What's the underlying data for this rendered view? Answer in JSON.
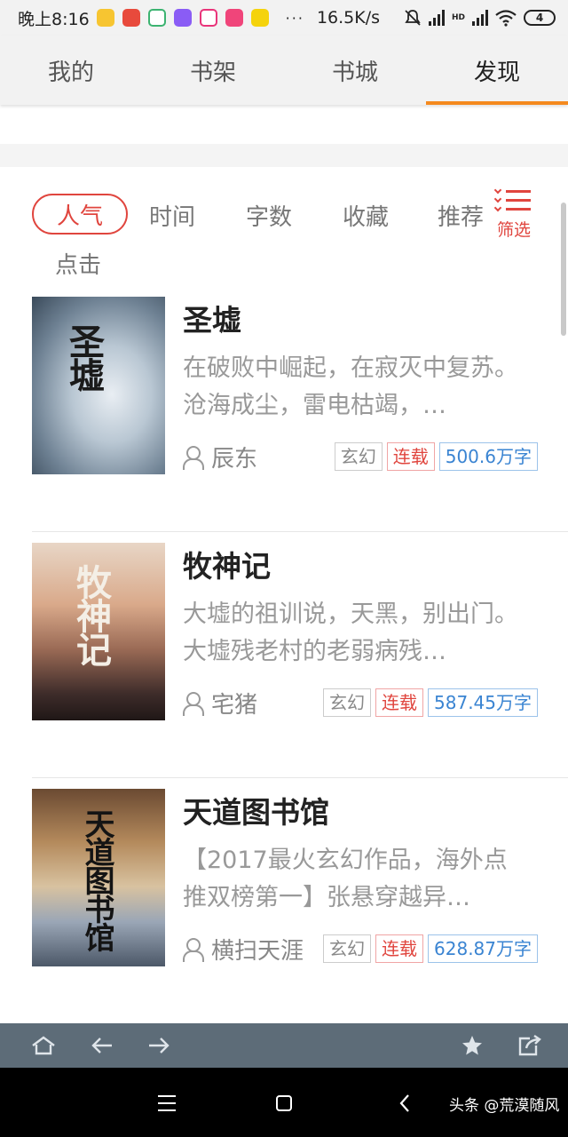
{
  "status_bar": {
    "time": "晚上8:16",
    "dots": "···",
    "speed": "16.5K/s",
    "network": "HD",
    "battery": "4"
  },
  "tabs": [
    {
      "label": "我的",
      "active": false
    },
    {
      "label": "书架",
      "active": false
    },
    {
      "label": "书城",
      "active": false
    },
    {
      "label": "发现",
      "active": true
    }
  ],
  "sort": {
    "options": [
      "人气",
      "时间",
      "字数",
      "收藏",
      "推荐",
      "点击"
    ],
    "active": "人气",
    "filter_label": "筛选"
  },
  "books": [
    {
      "title": "圣墟",
      "cover_title": "圣墟",
      "description": "在破败中崛起，在寂灭中复苏。沧海成尘，雷电枯竭，…",
      "author": "辰东",
      "genre": "玄幻",
      "status": "连载",
      "words": "500.6万字"
    },
    {
      "title": "牧神记",
      "cover_title": "牧神记",
      "description": "大墟的祖训说，天黑，别出门。大墟残老村的老弱病残…",
      "author": "宅猪",
      "genre": "玄幻",
      "status": "连载",
      "words": "587.45万字"
    },
    {
      "title": "天道图书馆",
      "cover_title": "天道图书馆",
      "description": "【2017最火玄幻作品，海外点推双榜第一】张悬穿越异…",
      "author": "横扫天涯",
      "genre": "玄幻",
      "status": "连载",
      "words": "628.87万字"
    }
  ],
  "watermark": "头条 @荒漠随风",
  "colors": {
    "accent_orange": "#f58a1f",
    "accent_red": "#e0453e",
    "tag_blue": "#3a84d2",
    "toolbar": "#5d6c78"
  }
}
